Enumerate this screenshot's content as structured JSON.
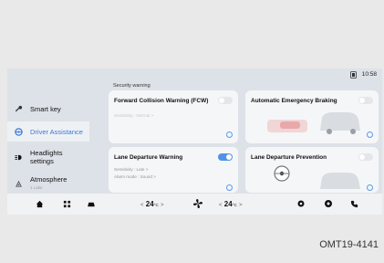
{
  "status_bar": {
    "time": "10:58"
  },
  "section_title": "Security warning",
  "sidebar": {
    "items": [
      {
        "label": "Smart key",
        "icon": "key-icon",
        "active": false
      },
      {
        "label": "Driver Assistance",
        "icon": "steering-wheel-icon",
        "active": true
      },
      {
        "label": "Headlights settings",
        "icon": "headlight-icon",
        "active": false
      },
      {
        "label": "Atmosphere",
        "sub": "1 Lake",
        "icon": "atmosphere-icon",
        "active": false
      }
    ]
  },
  "cards": {
    "fcw": {
      "title": "Forward Collision Warning (FCW)",
      "detail": "Sensitivity : Normal  >",
      "toggle": "off"
    },
    "aeb": {
      "title": "Automatic Emergency Braking",
      "toggle": "off"
    },
    "ldw": {
      "title": "Lane Departure Warning",
      "detail1": "Sensitivity : Late  >",
      "detail2": "Alarm mode : Sound  >",
      "toggle": "on"
    },
    "ldp": {
      "title": "Lane Departure Prevention",
      "toggle": "off"
    }
  },
  "bottom_bar": {
    "left_temp": "24",
    "right_temp": "24",
    "unit": "°C",
    "left_arrow": "<",
    "right_arrow": ">"
  },
  "caption": "OMT19-4141",
  "colors": {
    "accent": "#4f93e6",
    "active_label": "#3a78d8"
  }
}
